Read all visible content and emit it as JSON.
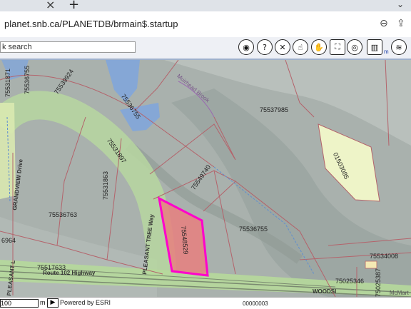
{
  "browser": {
    "tab_close_glyph": "×",
    "new_tab_glyph": "+",
    "tab_menu_glyph": "⌄",
    "url": "planet.snb.ca/PLANETDB/brmain$.startup",
    "icons": [
      "zoom-icon",
      "share-icon",
      "bookmark-star-icon"
    ]
  },
  "toolbar": {
    "search_placeholder": "k search",
    "buttons": [
      {
        "name": "globe-button",
        "glyph": "◉"
      },
      {
        "name": "help-identify-button",
        "glyph": "?"
      },
      {
        "name": "clear-button",
        "glyph": "✕"
      },
      {
        "name": "select-button",
        "glyph": "☝"
      },
      {
        "name": "pan-button",
        "glyph": "✋"
      },
      {
        "name": "full-extent-button",
        "glyph": "⛶"
      },
      {
        "name": "print-button",
        "glyph": "⎙"
      },
      {
        "name": "overview-button",
        "glyph": "◎"
      },
      {
        "name": "measure-button",
        "glyph": "▥"
      },
      {
        "name": "layers-button",
        "glyph": "≋"
      }
    ],
    "measure_unit": "m"
  },
  "map": {
    "parcels": [
      {
        "id": "parcel-75531871",
        "text": "75531871"
      },
      {
        "id": "parcel-75536755-a",
        "text": "75536755"
      },
      {
        "id": "parcel-75539924",
        "text": "75539924"
      },
      {
        "id": "parcel-75536755-b",
        "text": "75536755"
      },
      {
        "id": "parcel-75537985",
        "text": "75537985"
      },
      {
        "id": "parcel-01503085",
        "text": "01503085"
      },
      {
        "id": "parcel-75531897",
        "text": "75531897"
      },
      {
        "id": "parcel-75531863",
        "text": "75531863"
      },
      {
        "id": "parcel-75549740",
        "text": "75549740"
      },
      {
        "id": "parcel-75536763",
        "text": "75536763"
      },
      {
        "id": "parcel-75548529",
        "text": "75548529"
      },
      {
        "id": "parcel-75536755-c",
        "text": "75536755"
      },
      {
        "id": "parcel-75534008",
        "text": "75534008"
      },
      {
        "id": "parcel-75025346",
        "text": "75025346"
      },
      {
        "id": "parcel-75025387",
        "text": "75025387"
      },
      {
        "id": "parcel-6964",
        "text": "6964"
      },
      {
        "id": "parcel-75517633",
        "text": "75517633"
      }
    ],
    "roads": {
      "grandview": "GRANDVIEW Drive",
      "pleasant_tree": "PLEASANT TREE Way",
      "highway": "Route 102 Highway",
      "pleasant_l": "PLEASANT L",
      "woodside": "WOODSI"
    },
    "brook": "Muirhead Brook",
    "watermark": "McMart",
    "colors": {
      "highlight_fill": "#e8807f",
      "highlight_border": "#ff00cc",
      "lot_fill": "#eef4c8",
      "road_green": "#b6d99b"
    }
  },
  "status": {
    "scale_value": "100",
    "scale_unit": "m",
    "arrow_glyph": "▶",
    "powered_by": "Powered by ESRI",
    "bottom_parcel": "00000003"
  }
}
